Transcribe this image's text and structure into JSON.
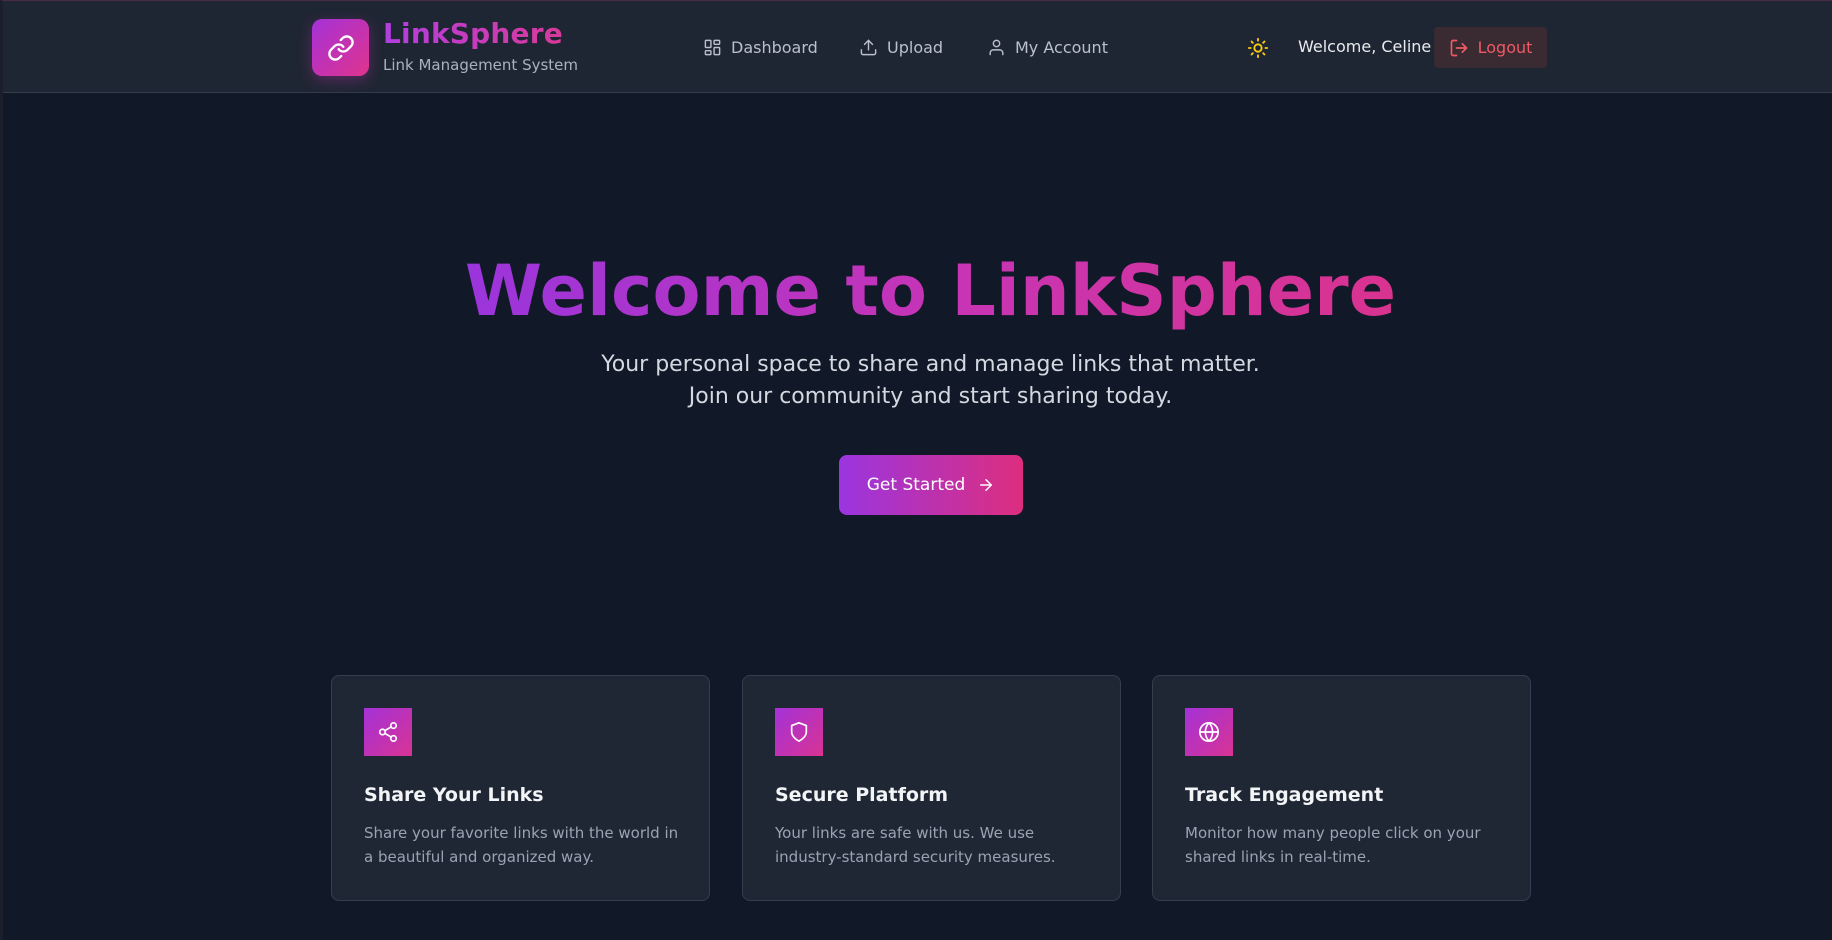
{
  "brand": {
    "name": "LinkSphere",
    "tagline": "Link Management System",
    "logo_icon": "link-icon"
  },
  "nav": {
    "items": [
      {
        "label": "Dashboard",
        "icon": "dashboard-icon"
      },
      {
        "label": "Upload",
        "icon": "upload-icon"
      },
      {
        "label": "My Account",
        "icon": "user-icon"
      }
    ]
  },
  "user": {
    "theme_icon": "sun-icon",
    "welcome": "Welcome, Celine",
    "logout_label": "Logout"
  },
  "hero": {
    "title": "Welcome to LinkSphere",
    "subtitle_line1": "Your personal space to share and manage links that matter.",
    "subtitle_line2": "Join our community and start sharing today.",
    "cta_label": "Get Started"
  },
  "features": [
    {
      "icon": "share-icon",
      "title": "Share Your Links",
      "description": "Share your favorite links with the world in a beautiful and organized way."
    },
    {
      "icon": "shield-icon",
      "title": "Secure Platform",
      "description": "Your links are safe with us. We use industry-standard security measures."
    },
    {
      "icon": "globe-icon",
      "title": "Track Engagement",
      "description": "Monitor how many people click on your shared links in real-time."
    }
  ],
  "colors": {
    "background": "#111827",
    "header": "#1f2633",
    "accent_start": "#9a35e0",
    "accent_end": "#dd2e7e",
    "logout_text": "#ef5a66",
    "sun": "#facc15"
  }
}
